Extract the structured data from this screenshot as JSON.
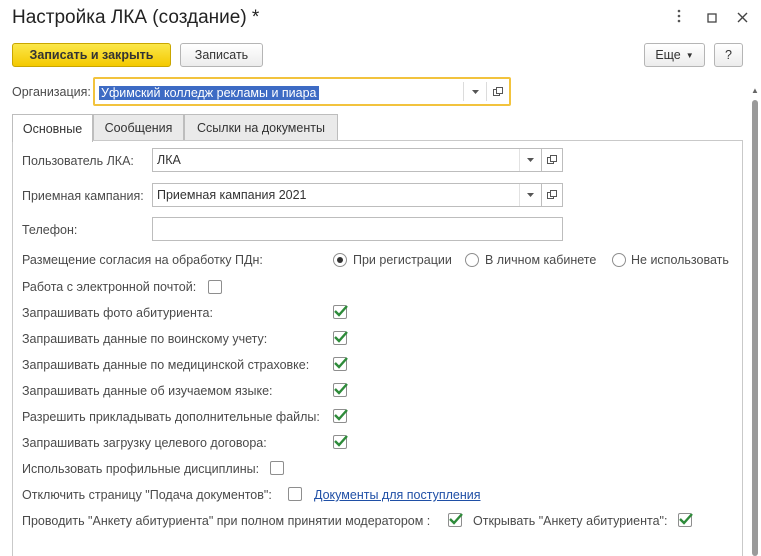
{
  "window": {
    "title": "Настройка ЛКА (создание) *",
    "more_icon": "more-vertical-icon",
    "maximize_icon": "maximize-icon",
    "close_icon": "close-icon"
  },
  "toolbar": {
    "save_close_label": "Записать и закрыть",
    "save_label": "Записать",
    "more_label": "Еще",
    "help_label": "?"
  },
  "organization": {
    "label": "Организация:",
    "value": "Уфимский колледж рекламы и пиара"
  },
  "tabs": [
    {
      "label": "Основные",
      "active": true
    },
    {
      "label": "Сообщения",
      "active": false
    },
    {
      "label": "Ссылки на документы",
      "active": false
    }
  ],
  "form": {
    "user_label": "Пользователь ЛКА:",
    "user_value": "ЛКА",
    "campaign_label": "Приемная кампания:",
    "campaign_value": "Приемная кампания 2021",
    "phone_label": "Телефон:",
    "phone_value": "",
    "consent_label": "Размещение согласия на обработку ПДн:",
    "consent_options": [
      {
        "label": "При регистрации",
        "selected": true
      },
      {
        "label": "В личном кабинете",
        "selected": false
      },
      {
        "label": "Не использовать",
        "selected": false
      }
    ],
    "checkboxes": [
      {
        "label": "Работа с электронной почтой:",
        "checked": false
      },
      {
        "label": "Запрашивать фото абитуриента:",
        "checked": true
      },
      {
        "label": "Запрашивать данные по воинскому учету:",
        "checked": true
      },
      {
        "label": "Запрашивать данные по медицинской страховке:",
        "checked": true
      },
      {
        "label": "Запрашивать данные об изучаемом языке:",
        "checked": true
      },
      {
        "label": "Разрешить прикладывать дополнительные файлы:",
        "checked": true
      },
      {
        "label": "Запрашивать загрузку целевого договора:",
        "checked": true
      },
      {
        "label": "Использовать профильные дисциплины:",
        "checked": false
      }
    ],
    "disable_page_label": "Отключить страницу \"Подача документов\":",
    "disable_page_checked": false,
    "documents_link": "Документы для поступления",
    "conduct_label": "Проводить \"Анкету абитуриента\" при полном принятии модератором :",
    "conduct_checked": true,
    "open_label": "Открывать \"Анкету абитуриента\":",
    "open_checked": true
  },
  "colors": {
    "primary_button": "#f4c900",
    "focus_border": "#f2c33d",
    "selection": "#3d6bc4",
    "check": "#2e8b3a",
    "link": "#1f4fa6"
  }
}
